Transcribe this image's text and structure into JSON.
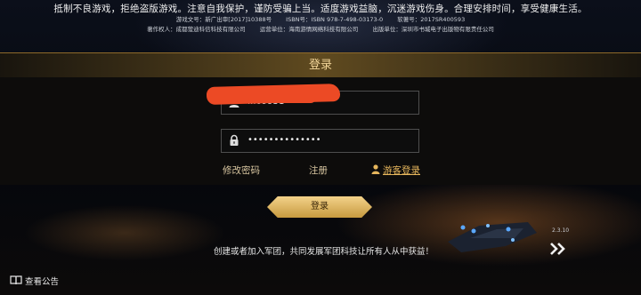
{
  "notice": {
    "line1": "抵制不良游戏，拒绝盗版游戏。注意自我保护，谨防受骗上当。适度游戏益脑，沉迷游戏伤身。合理安排时间，享受健康生活。",
    "line2": [
      "游戏文号：新广出审[2017]10388号",
      "ISBN号：ISBN 978-7-498-03173-0",
      "软著号：2017SR400593"
    ],
    "line3": [
      "著作权人：成都萤迪科信科技有限公司",
      "运营单位：海南游情网络科技有限公司",
      "出版单位：深圳市书城电子出版物有限责任公司"
    ]
  },
  "login": {
    "title": "登录",
    "account_value": "...09951",
    "password_value": "••••••••••••••",
    "change_password_label": "修改密码",
    "register_label": "注册",
    "guest_login_label": "游客登录",
    "submit_label": "登录"
  },
  "footer": {
    "version": "2.3.10",
    "slogan": "创建或者加入军团，共同发展军团科技让所有人从中获益！",
    "notice_label": "查看公告"
  },
  "colors": {
    "accent_gold": "#e6b65c",
    "button_gold": "#d9b060",
    "redaction": "#ec4a25"
  },
  "icons": [
    "user-icon",
    "lock-icon",
    "guest-icon",
    "double-chevron-right-icon",
    "book-icon"
  ]
}
